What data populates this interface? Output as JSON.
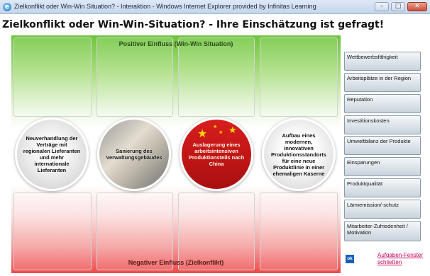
{
  "window": {
    "icon": "ie-icon",
    "title": "Zielkonflikt oder Win-Win Situation? - Interaktion - Windows Internet Explorer provided by Infinitas Learning",
    "controls": {
      "minimize": "–",
      "maximize": "□",
      "close": "✕"
    }
  },
  "page": {
    "title": "Zielkonflikt oder Win-Win-Situation? - Ihre Einschätzung ist gefragt!"
  },
  "board": {
    "positive_label": "Positiver Einfluss (Win-Win Situation)",
    "negative_label": "Negativer Einfluss (Zielkonflikt)",
    "positive_color": "#6cc53a",
    "negative_color": "#ee4a4a",
    "cards": [
      {
        "text": "Neuverhandlung der Verträge mit regionalen Lieferanten und mehr internationale Lieferanten"
      },
      {
        "text": "Sanierung des Verwaltungsgebäudes"
      },
      {
        "text": "Auslagerung eines arbeitsintensiven Produktionsteils nach China"
      },
      {
        "text": "Aufbau eines modernen, innovativen Produktionsstandorts für eine neue Produktlinie in einer ehemaligen Kaserne"
      }
    ]
  },
  "sidebar": {
    "items": [
      {
        "label": "Wettbewerbsfähigkeit"
      },
      {
        "label": "Arbeitsplätze in der Region"
      },
      {
        "label": "Reputation"
      },
      {
        "label": "Investitionskosten"
      },
      {
        "label": "Umweltbilanz der Produkte"
      },
      {
        "label": "Einsparungen"
      },
      {
        "label": "Produktqualität"
      },
      {
        "label": "Lärmemission/-schutz"
      },
      {
        "label": "Mitarbeiter-Zufriedenheit / Motivation"
      }
    ],
    "ok_label": "ok",
    "close_link": "Aufgaben-Fenster schließen",
    "accent": "#1560b8",
    "link_color": "#c4005b"
  }
}
